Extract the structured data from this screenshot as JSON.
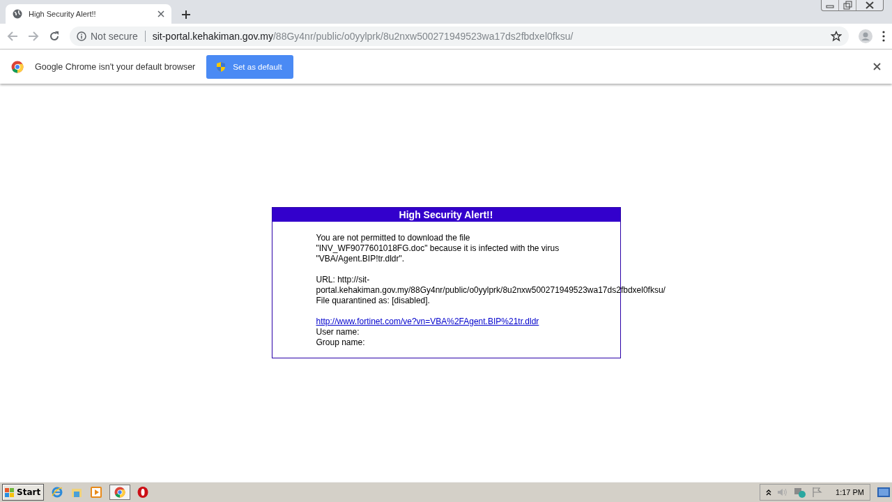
{
  "tab": {
    "title": "High Security Alert!!",
    "selected": true
  },
  "toolbar": {
    "security_label": "Not secure",
    "url_host": "sit-portal.kehakiman.gov.my",
    "url_path": "/88Gy4nr/public/o0yylprk/8u2nxw500271949523wa17ds2fbdxel0fksu/"
  },
  "infobar": {
    "message": "Google Chrome isn't your default browser",
    "button": "Set as default"
  },
  "alert": {
    "title": "High Security Alert!!",
    "message": "You are not permitted to download the file \"INV_WF9077601018FG.doc\" because it is infected with the virus \"VBA/Agent.BIP!tr.dldr\".",
    "url": "URL: http://sit-portal.kehakiman.gov.my/88Gy4nr/public/o0yylprk/8u2nxw500271949523wa17ds2fbdxel0fksu/",
    "quarantine": "File quarantined as: [disabled].",
    "link": "http://www.fortinet.com/ve?vn=VBA%2FAgent.BIP%21tr.dldr",
    "user_name": "User name:",
    "group_name": "Group name:"
  },
  "taskbar": {
    "start": "Start",
    "clock": "1:17 PM"
  }
}
